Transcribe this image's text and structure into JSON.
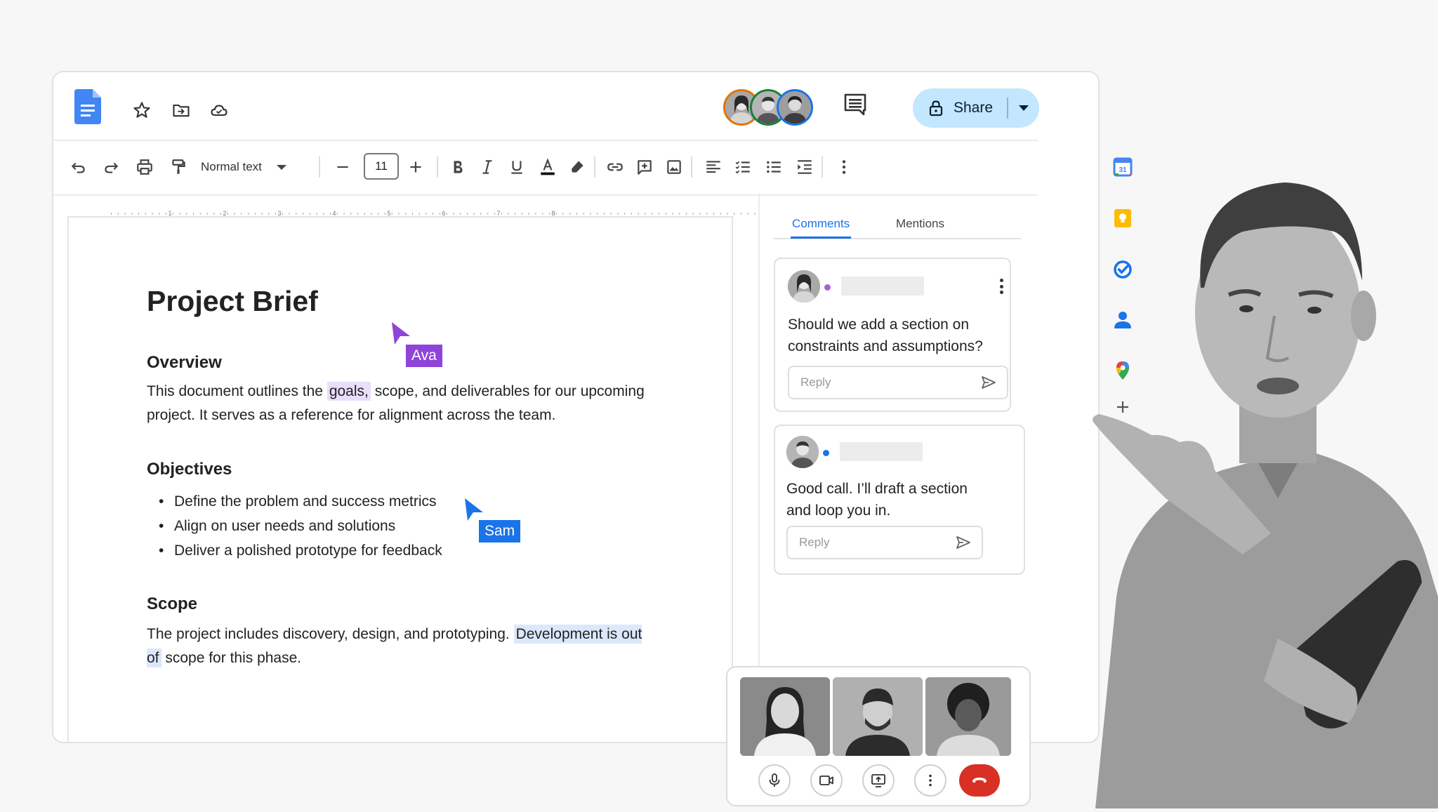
{
  "header": {
    "share_label": "Share"
  },
  "toolbar": {
    "paragraph_style": "Normal text",
    "font_size": "11"
  },
  "ruler": {
    "ticks": [
      "1",
      "2",
      "3",
      "4",
      "5",
      "6",
      "7",
      "8"
    ]
  },
  "document": {
    "title": "Project Brief",
    "overview": {
      "heading": "Overview",
      "text_before": "This document outlines the ",
      "highlight": "goals,",
      "text_after": " scope, and deliverables for our upcoming project. It serves as a reference for alignment across the team."
    },
    "objectives": {
      "heading": "Objectives",
      "items": [
        "Define the problem and success metrics",
        "Align on user needs and solutions",
        "Deliver a polished prototype for feedback"
      ]
    },
    "scope": {
      "heading": "Scope",
      "text_before": "The project includes discovery, design, and prototyping. ",
      "highlight": "Development is out of",
      "text_after": " scope for this phase."
    }
  },
  "collaborators": [
    {
      "name": "Ava",
      "color": "#8e44d8"
    },
    {
      "name": "Sam",
      "color": "#1a73e8"
    }
  ],
  "comments_panel": {
    "tabs": [
      "Comments",
      "Mentions"
    ],
    "active_tab": "Comments",
    "comments": [
      {
        "text": "Should we add a section on constraints and assumptions?",
        "reply_placeholder": "Reply",
        "dot_color": "#a461d8"
      },
      {
        "text": "Good call. I’ll draft a section and loop you in.",
        "reply_placeholder": "Reply",
        "dot_color": "#1a73e8"
      }
    ]
  },
  "side_apps": [
    "calendar-icon",
    "keep-icon",
    "tasks-icon",
    "contacts-icon",
    "maps-icon",
    "add-icon"
  ],
  "side_apps_calendar_day": "31",
  "colors": {
    "accent": "#1a73e8",
    "share_bg": "#c2e7ff",
    "end_call": "#d93025"
  }
}
